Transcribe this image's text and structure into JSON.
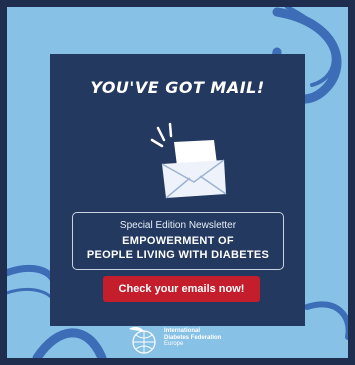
{
  "card": {
    "headline": "YOU'VE GOT MAIL!",
    "subtitle": "Special Edition Newsletter",
    "title_line1": "EMPOWERMENT OF",
    "title_line2": "PEOPLE LIVING WITH DIABETES",
    "cta_label": "Check your emails now!"
  },
  "logo": {
    "line1": "International",
    "line2": "Diabetes Federation",
    "line3": "Europe"
  },
  "colors": {
    "frame": "#1f2d4e",
    "background": "#87c1e6",
    "card": "#24395f",
    "cta": "#c41d2b",
    "swirl": "#2f5fae"
  },
  "icons": [
    "envelope-icon",
    "idf-logo-icon"
  ]
}
